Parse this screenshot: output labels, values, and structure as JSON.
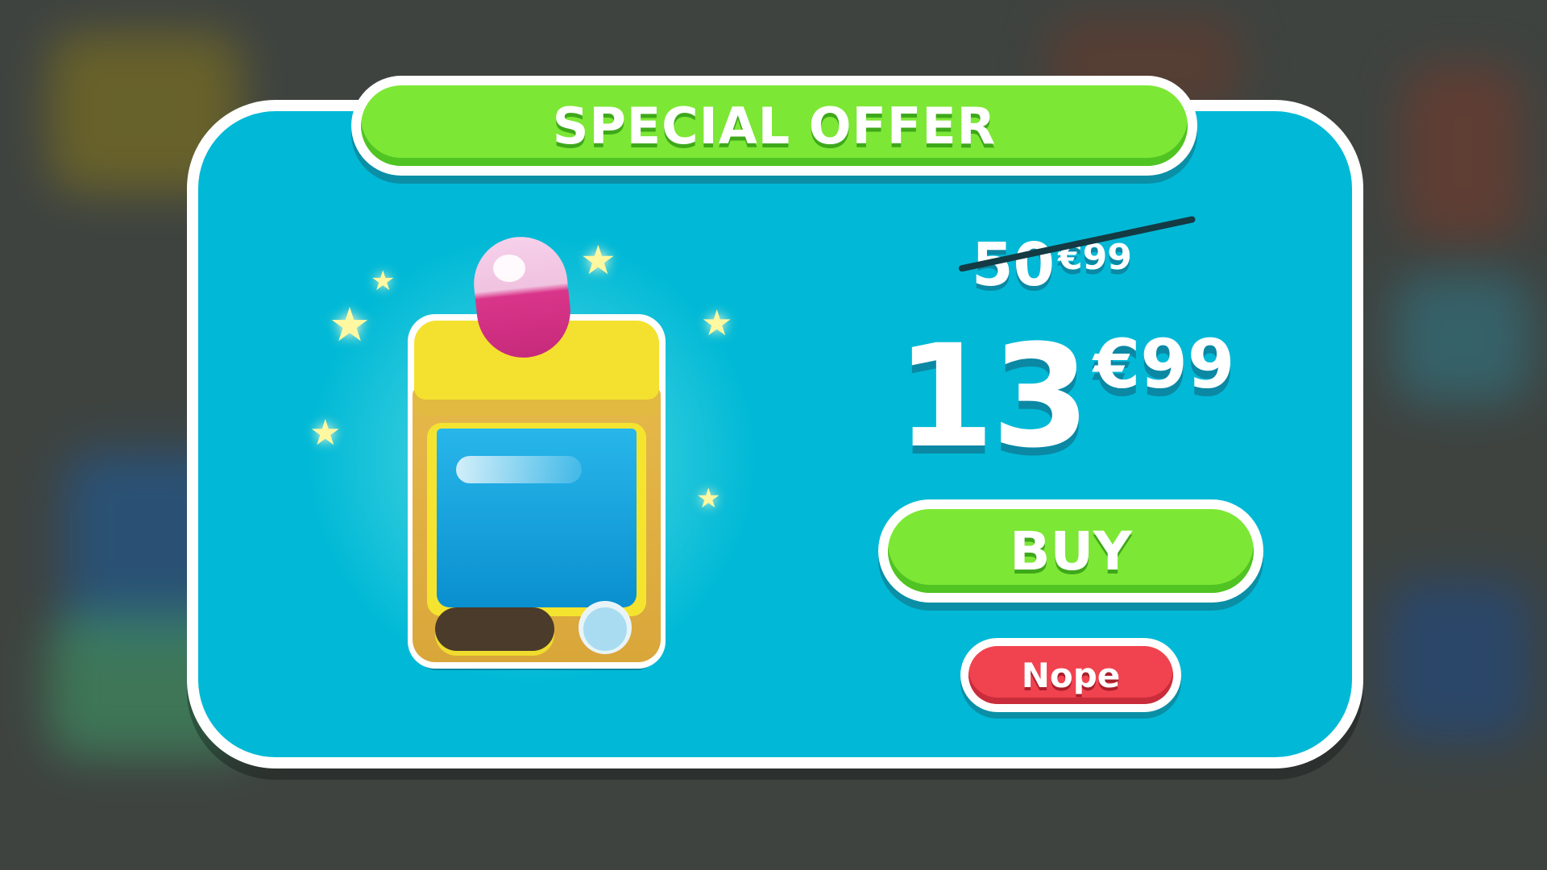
{
  "offer": {
    "title": "SPECIAL OFFER",
    "original_price": {
      "integer": "50",
      "decimal": "€99"
    },
    "sale_price": {
      "integer": "13",
      "decimal": "€99"
    },
    "buy_label": "BUY",
    "decline_label": "Nope"
  },
  "item": {
    "icon": "capsule-vending-machine-icon"
  },
  "colors": {
    "panel": "#01b9d6",
    "accent_green": "#7de735",
    "decline_red": "#f0434f",
    "background": "#3e4340"
  }
}
